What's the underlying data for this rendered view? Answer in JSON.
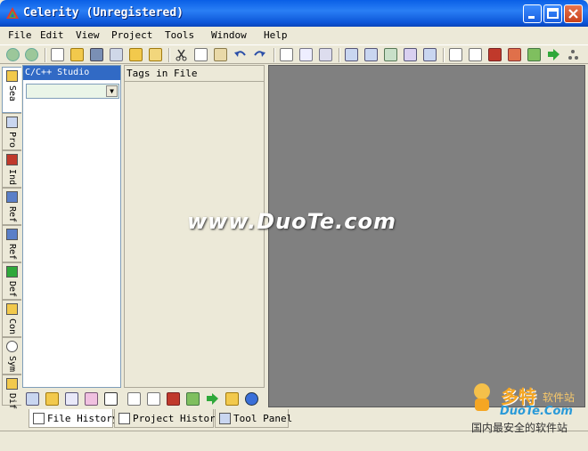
{
  "window": {
    "title": "Celerity (Unregistered)"
  },
  "menu": [
    "File",
    "Edit",
    "View",
    "Project",
    "Tools",
    "Window",
    "Help"
  ],
  "side_tabs": [
    "Sea",
    "Pro",
    "Ind",
    "Ref",
    "Ref",
    "Def",
    "Con",
    "Sym",
    "Dif"
  ],
  "panel1": {
    "header": "C/C++ Studio",
    "combo_value": ""
  },
  "panel2": {
    "header": "Tags in File"
  },
  "bottom_tabs": [
    "File History",
    "Project History",
    "Tool Panel"
  ],
  "watermark": "www.DuoTe.com",
  "logo": {
    "brand": "多特",
    "sub": "软件站",
    "url": "DuoTe.Com",
    "slogan": "国内最安全的软件站"
  },
  "colors": {
    "titlebar": "#0a5fe6",
    "selection": "#316ac5",
    "editor_bg": "#808080",
    "chrome": "#ece9d8"
  }
}
